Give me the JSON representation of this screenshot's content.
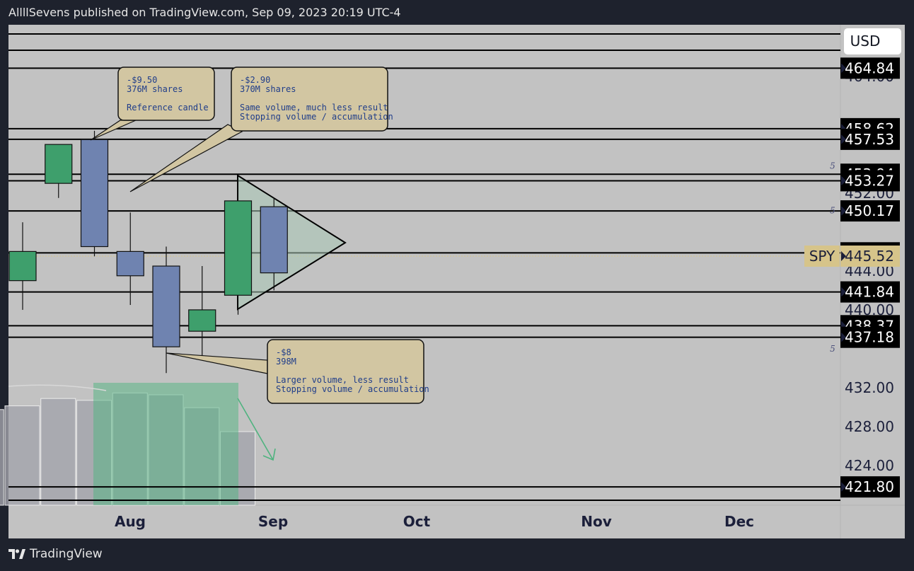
{
  "header": {
    "attribution": "AllllSevens published on TradingView.com, Sep 09, 2023 20:19 UTC-4"
  },
  "footer": {
    "brand": "TradingView",
    "logo_icon": "tradingview-logo-icon"
  },
  "colors": {
    "background": "#1e222d",
    "pane": "#c2c2c2",
    "bull": "#3e9f6c",
    "bear": "#6f83b0",
    "label_bg": "#000000",
    "spy_label": "#d6c48a",
    "note_bg": "#d2c6a2"
  },
  "chart_data": {
    "type": "candlestick",
    "symbol": "SPY",
    "currency": "USD",
    "last_price": "445.52",
    "x_tick_labels": [
      "Aug",
      "Sep",
      "Oct",
      "Nov",
      "Dec"
    ],
    "y_tick_labels": [
      "464.00",
      "452.00",
      "444.00",
      "440.00",
      "432.00",
      "428.00",
      "424.00"
    ],
    "candles": [
      {
        "date": "Jul 21",
        "open": 443.0,
        "high": 449.0,
        "low": 440.0,
        "close": 446.0
      },
      {
        "date": "Jul 28",
        "open": 453.0,
        "high": 456.5,
        "low": 451.5,
        "close": 457.0
      },
      {
        "date": "Aug 04",
        "open": 457.5,
        "high": 458.4,
        "low": 445.5,
        "close": 446.5
      },
      {
        "date": "Aug 11",
        "open": 446.0,
        "high": 450.0,
        "low": 440.5,
        "close": 443.5
      },
      {
        "date": "Aug 18",
        "open": 444.5,
        "high": 446.5,
        "low": 433.5,
        "close": 436.2
      },
      {
        "date": "Aug 25",
        "open": 437.8,
        "high": 444.5,
        "low": 435.0,
        "close": 440.0
      },
      {
        "date": "Sep 01",
        "open": 441.5,
        "high": 453.5,
        "low": 439.5,
        "close": 451.2
      },
      {
        "date": "Sep 08",
        "open": 450.6,
        "high": 451.5,
        "low": 442.0,
        "close": 443.8
      }
    ],
    "volume_bars": [
      {
        "date": "Jul 14",
        "value": 0.52
      },
      {
        "date": "Jul 21",
        "value": 0.54
      },
      {
        "date": "Jul 28",
        "value": 0.58
      },
      {
        "date": "Aug 04",
        "value": 0.57
      },
      {
        "date": "Aug 11",
        "value": 0.61
      },
      {
        "date": "Aug 18",
        "value": 0.6
      },
      {
        "date": "Aug 25",
        "value": 0.53
      },
      {
        "date": "Sep 01",
        "value": 0.4
      }
    ],
    "horizontal_levels": [
      "464.84",
      "458.62",
      "457.53",
      "453.94",
      "453.27",
      "450.17",
      "445.86",
      "441.84",
      "438.37",
      "437.18",
      "421.80"
    ],
    "level_marker": "5",
    "annotations": [
      {
        "lines": [
          "-$9.50",
          "376M shares",
          "",
          "Reference candle"
        ]
      },
      {
        "lines": [
          "-$2.90",
          "370M shares",
          "",
          "Same volume, much less result",
          "Stopping volume / accumulation"
        ]
      },
      {
        "lines": [
          "-$8",
          "398M",
          "",
          "Larger volume, less result",
          "Stopping volume / accumulation"
        ]
      }
    ]
  }
}
